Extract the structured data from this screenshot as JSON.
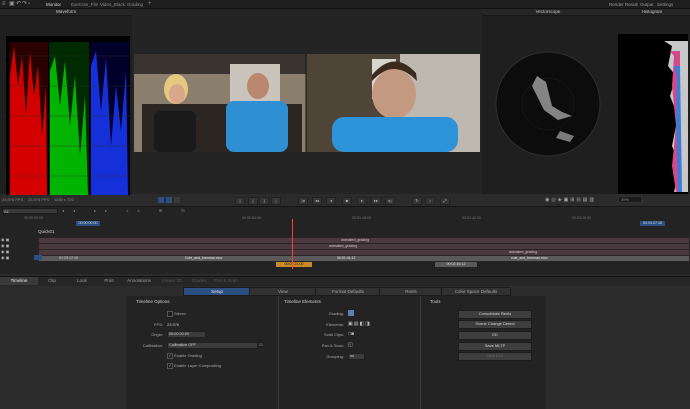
{
  "topbar": {
    "tabs": [
      "Monitor",
      "Exercise_File",
      "Video_Black",
      "Grading",
      "+"
    ],
    "right": [
      "Render Result",
      "Output",
      "Settings"
    ]
  },
  "panels": {
    "waveform": "Waveform",
    "vectorscope": "Vectorscope",
    "histogram": "Histogram"
  },
  "status": {
    "fps_left": "23.976 FPS",
    "fps_mid": "23.976 FPS",
    "resolution": "1280 x 720",
    "zoom": "39%"
  },
  "timeline": {
    "ruler_left": "00:00:00:00",
    "ruler_right": "00:03:27:18",
    "track_name": "Quick01",
    "ticks": [
      "00:00:00:00",
      "00:00:54:00",
      "00:01:48:00",
      "00:02:42:00",
      "00:03:36:00"
    ],
    "segments": [
      "animated_grading",
      "animated_grading",
      "animated_grading",
      "Cole_and_brennan.mov",
      "00:01:21:00",
      "00:01:41:12",
      "00:02:16:12",
      "animated_grading",
      "cole_and_brennan.mov"
    ],
    "in_out": [
      "01:23:17:10",
      "00:00:01:10"
    ]
  },
  "bottom_tabs": [
    "Timeline",
    "Clip",
    "Look",
    "Print",
    "Annotations",
    "Viewer 3D",
    "Grades",
    "Pan & Scan"
  ],
  "sub_tabs": [
    "Setup",
    "View",
    "Format Defaults",
    "Reels",
    "Color Space Defaults"
  ],
  "timeline_options": {
    "title": "Timeline Options",
    "stereo_label": "Stereo",
    "fps_label": "FPS:",
    "fps_value": "23.976",
    "origin_label": "Origin:",
    "origin_value": "00:00:00:00",
    "calibration_label": "Calibration:",
    "calibration_value": "Calibration OFF",
    "enable_grading": "Enable Grading",
    "enable_layer": "Enable Layer Compositing"
  },
  "timeline_elements": {
    "title": "Timeline Elements",
    "grading_label": "Grading:",
    "elements_label": "Elements:",
    "solid_label": "Solid Clips:",
    "pan_label": "Pan & Scan:",
    "grouping_label": "Grouping:",
    "grouping_value": "on"
  },
  "tools": {
    "title": "Tools",
    "buttons": [
      "Consolidate Reels",
      "Scene Change Detect",
      "ED",
      "Save MLTP",
      "Save EDL"
    ]
  },
  "colors": {
    "accent": "#2b4f80",
    "track": "#4a3a3f",
    "playhead": "#ff3a3a"
  }
}
